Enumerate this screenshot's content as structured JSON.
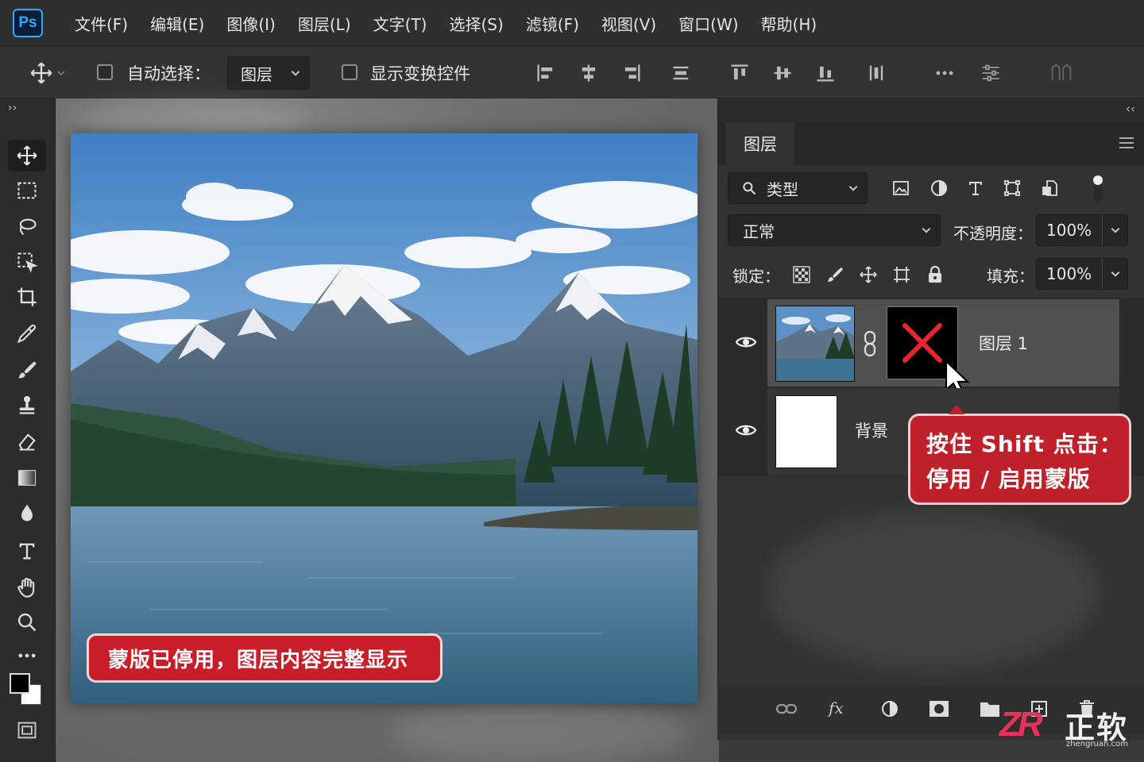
{
  "app": {
    "logo_text": "Ps"
  },
  "menu": [
    "文件(F)",
    "编辑(E)",
    "图像(I)",
    "图层(L)",
    "文字(T)",
    "选择(S)",
    "滤镜(F)",
    "视图(V)",
    "窗口(W)",
    "帮助(H)"
  ],
  "options": {
    "auto_select_label": "自动选择：",
    "auto_select_value": "图层",
    "show_transform_label": "显示变换控件"
  },
  "toolbar": {
    "collapse": "››"
  },
  "canvas": {
    "callout": "蒙版已停用，图层内容完整显示"
  },
  "layers_panel": {
    "collapse": "‹‹",
    "tab": "图层",
    "filter_label": "类型",
    "blend_mode": "正常",
    "opacity_label": "不透明度：",
    "opacity_value": "100%",
    "lock_label": "锁定：",
    "fill_label": "填充：",
    "fill_value": "100%",
    "layers": [
      {
        "name": "图层 1"
      },
      {
        "name": "背景"
      }
    ],
    "callout_line1": "按住 Shift 点击：",
    "callout_line2": "停用 / 启用蒙版"
  },
  "watermark": {
    "letters": "ZR",
    "brand": "正软",
    "url": "zhengruan.com"
  },
  "colors": {
    "accent_red": "#c81e2a",
    "ps_blue": "#31a8ff",
    "panel_bg": "#323232"
  }
}
